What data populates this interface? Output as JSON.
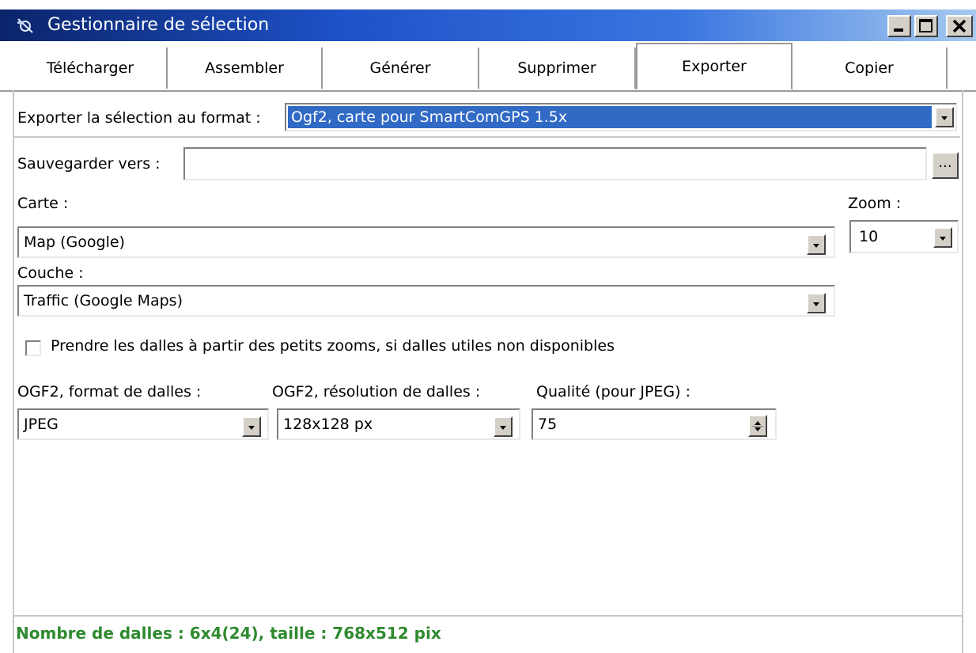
{
  "window": {
    "title": "Gestionnaire de sélection",
    "minimize_icon": "minimize-icon",
    "maximize_icon": "maximize-icon",
    "close_icon": "close-icon",
    "app_icon": "satellite-icon"
  },
  "tabs": [
    {
      "label": "Télécharger",
      "active": false
    },
    {
      "label": "Assembler",
      "active": false
    },
    {
      "label": "Générer",
      "active": false
    },
    {
      "label": "Supprimer",
      "active": false
    },
    {
      "label": "Exporter",
      "active": true
    },
    {
      "label": "Copier",
      "active": false
    }
  ],
  "export": {
    "format_label": "Exporter la sélection au format :",
    "format_value": "Ogf2, carte pour SmartComGPS 1.5x",
    "save_label": "Sauvegarder vers :",
    "save_value": "",
    "browse_label": "..."
  },
  "map": {
    "carte_label": "Carte :",
    "carte_value": "Map (Google)",
    "zoom_label": "Zoom :",
    "zoom_value": "10",
    "couche_label": "Couche :",
    "couche_value": "Traffic (Google Maps)"
  },
  "options": {
    "small_zoom_label": "Prendre les dalles à partir des petits zooms, si dalles utiles non disponibles",
    "small_zoom_checked": false,
    "tile_format_label": "OGF2, format de dalles :",
    "tile_format_value": "JPEG",
    "tile_res_label": "OGF2, résolution de dalles :",
    "tile_res_value": "128x128 px",
    "quality_label": "Qualité (pour JPEG) :",
    "quality_value": "75"
  },
  "status": {
    "text": "Nombre de dalles : 6x4(24), taille : 768x512 pix",
    "color": "#2f8a2f"
  },
  "colors": {
    "title_bar": "#1e52c8",
    "selection": "#316ac5"
  }
}
